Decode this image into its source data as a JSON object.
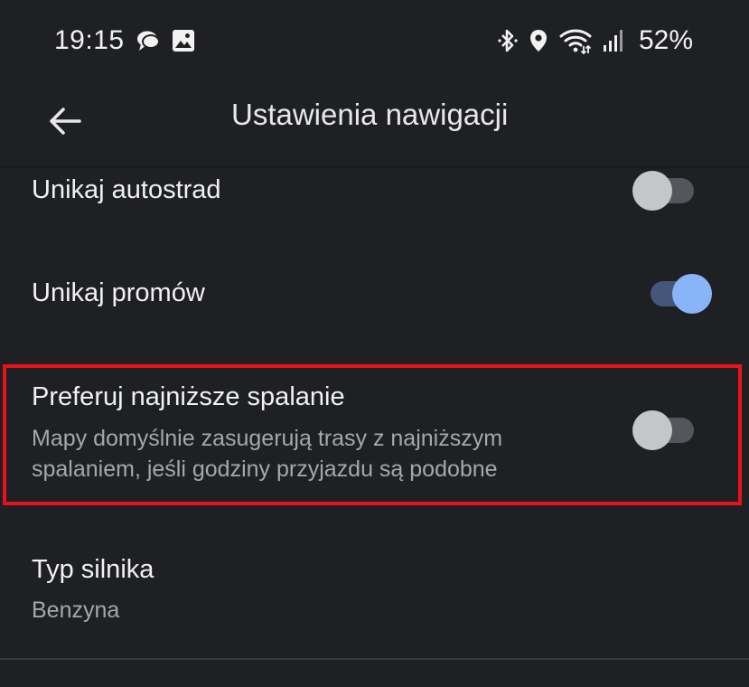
{
  "status_bar": {
    "time": "19:15",
    "battery": "52%",
    "left_icons": [
      "chat-bubble-icon",
      "image-icon"
    ],
    "right_icons": [
      "bluetooth-icon",
      "location-pin-icon",
      "wifi-icon",
      "signal-icon"
    ]
  },
  "app_bar": {
    "back_icon": "arrow-back-icon",
    "title": "Ustawienia nawigacji"
  },
  "settings": [
    {
      "title": "Unikaj autostrad",
      "subtitle": "",
      "toggle": "off"
    },
    {
      "title": "Unikaj promów",
      "subtitle": "",
      "toggle": "on"
    },
    {
      "title": "Preferuj najniższe spalanie",
      "subtitle_line1": "Mapy domyślnie zasugerują trasy z najniższym",
      "subtitle_line2": "spalaniem, jeśli godziny przyjazdu są podobne",
      "toggle": "off",
      "highlighted": true
    },
    {
      "title": "Typ silnika",
      "value": "Benzyna"
    }
  ],
  "colors": {
    "background": "#1f2023",
    "toggle_on_thumb": "#8ab4f8",
    "toggle_off_thumb": "#c5c6c9",
    "highlight_border": "#e8131a"
  }
}
